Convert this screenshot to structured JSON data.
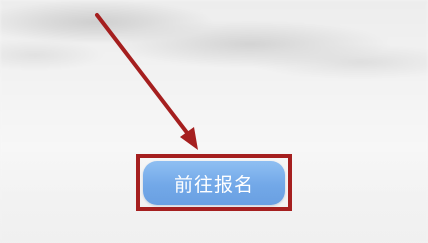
{
  "cta": {
    "label": "前往报名"
  },
  "annotation": {
    "arrow_color": "#a51f1f",
    "box_color": "#a51f1f"
  },
  "colors": {
    "button_top": "#8fbff2",
    "button_bottom": "#6aa0e2",
    "button_text": "#ffffff"
  }
}
